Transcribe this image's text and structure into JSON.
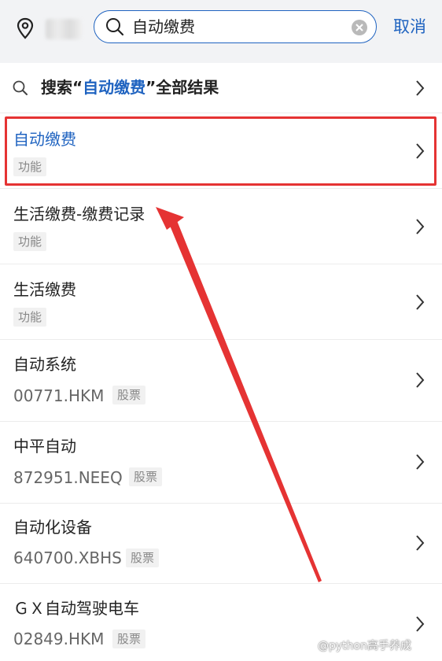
{
  "header": {
    "search_value": "自动缴费",
    "cancel_label": "取消"
  },
  "all_results": {
    "prefix": "搜索“",
    "keyword": "自动缴费",
    "suffix": "”全部结果"
  },
  "results": [
    {
      "title": "自动缴费",
      "tag": "功能"
    },
    {
      "title": "生活缴费-缴费记录",
      "tag": "功能"
    },
    {
      "title": "生活缴费",
      "tag": "功能"
    },
    {
      "title": "自动系统",
      "code": "00771.HKM",
      "tag": "股票"
    },
    {
      "title": "中平自动",
      "code": "872951.NEEQ",
      "tag": "股票"
    },
    {
      "title": "自动化设备",
      "code": "640700.XBHS",
      "tag": "股票"
    },
    {
      "title": "ＧＸ自动驾驶电车",
      "code": "02849.HKM",
      "tag": "股票"
    }
  ],
  "watermark": "@python高手养成",
  "colors": {
    "accent": "#1f63c0",
    "annotation_red": "#e53333"
  }
}
